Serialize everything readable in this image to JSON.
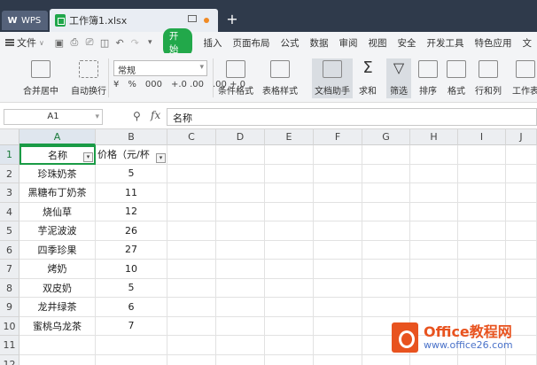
{
  "titlebar": {
    "wps_tab": "WPS",
    "file_tab": "工作簿1.xlsx",
    "new_tab": "+"
  },
  "menubar": {
    "file_label": "文件",
    "start_label": "开始",
    "items": [
      "插入",
      "页面布局",
      "公式",
      "数据",
      "审阅",
      "视图",
      "安全",
      "开发工具",
      "特色应用",
      "文"
    ]
  },
  "ribbon": {
    "merge_label": "合并居中",
    "wrap_label": "自动换行",
    "format_select": "常规",
    "num_format": [
      "¥",
      "%",
      "000",
      "+.0 .00",
      ".00 +.0"
    ],
    "cond_format_label": "条件格式",
    "table_style_label": "表格样式",
    "doc_assist_label": "文档助手",
    "sum_label": "求和",
    "filter_label": "筛选",
    "sort_label": "排序",
    "format_label": "格式",
    "rowcol_label": "行和列",
    "sheet_label": "工作表"
  },
  "formula_bar": {
    "name_box": "A1",
    "fx": "fx",
    "value": "名称"
  },
  "sheet": {
    "columns": [
      "A",
      "B",
      "C",
      "D",
      "E",
      "F",
      "G",
      "H",
      "I",
      "J"
    ],
    "rows": [
      "1",
      "2",
      "3",
      "4",
      "5",
      "6",
      "7",
      "8",
      "9",
      "10",
      "11",
      "12"
    ],
    "header": [
      "名称",
      "价格（元/杯"
    ],
    "data": [
      [
        "珍珠奶茶",
        "5"
      ],
      [
        "黑糖布丁奶茶",
        "11"
      ],
      [
        "烧仙草",
        "12"
      ],
      [
        "芋泥波波",
        "26"
      ],
      [
        "四季珍果",
        "27"
      ],
      [
        "烤奶",
        "10"
      ],
      [
        "双皮奶",
        "5"
      ],
      [
        "龙井绿茶",
        "6"
      ],
      [
        "蜜桃乌龙茶",
        "7"
      ]
    ]
  },
  "watermark": {
    "line1": "Office教程网",
    "line2": "www.office26.com"
  }
}
